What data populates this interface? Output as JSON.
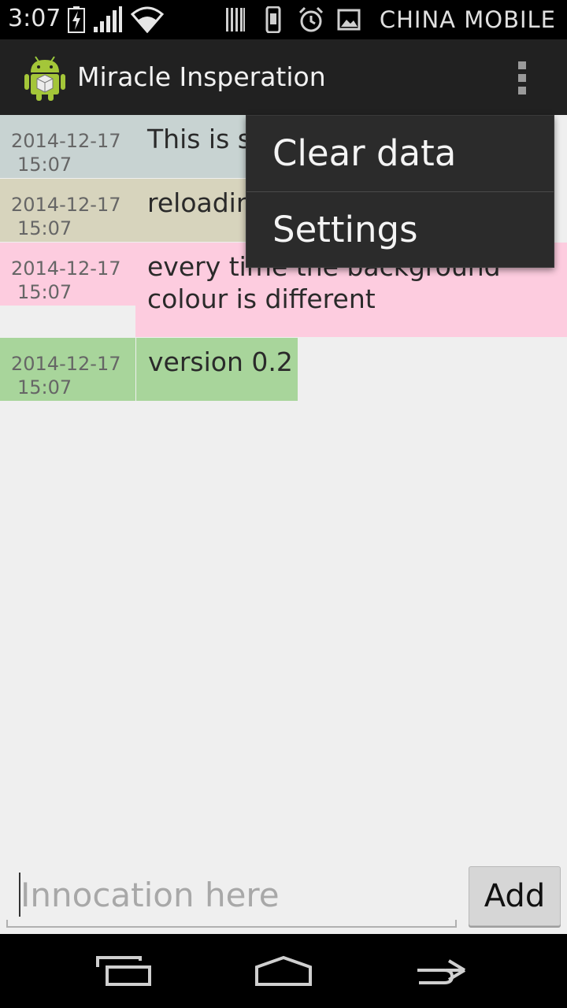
{
  "status_bar": {
    "time": "3:07",
    "carrier": "CHINA  MOBILE"
  },
  "action_bar": {
    "title": "Miracle Insperation"
  },
  "entries": [
    {
      "date": "2014-12-17",
      "time": "15:07",
      "text": "This is s",
      "color": "#c8d3d2",
      "text_color": "#c8d3d2"
    },
    {
      "date": "2014-12-17",
      "time": "15:07",
      "text": "reloadin",
      "color": "#d7d4bd",
      "text_color": "#d7d4bd"
    },
    {
      "date": "2014-12-17",
      "time": "15:07",
      "text_line1": "every time the background",
      "text_line2": "colour is different",
      "color": "#fdccdf"
    },
    {
      "date": "2014-12-17",
      "time": "15:07",
      "text": "version 0.2",
      "color": "#a8d59b"
    }
  ],
  "menu": {
    "items": [
      "Clear data",
      "Settings"
    ]
  },
  "input": {
    "placeholder": "Innocation here",
    "add_label": "Add"
  },
  "colors": {
    "action_bar_bg": "#212121",
    "menu_bg": "#2b2b2b",
    "content_bg": "#efefef"
  },
  "icons": [
    "charging-icon",
    "signal-icon",
    "wifi-icon",
    "barcode-icon",
    "phone-icon",
    "alarm-icon",
    "image-icon",
    "android-app-icon",
    "overflow-menu-icon",
    "recent-apps-icon",
    "home-icon",
    "back-icon"
  ]
}
